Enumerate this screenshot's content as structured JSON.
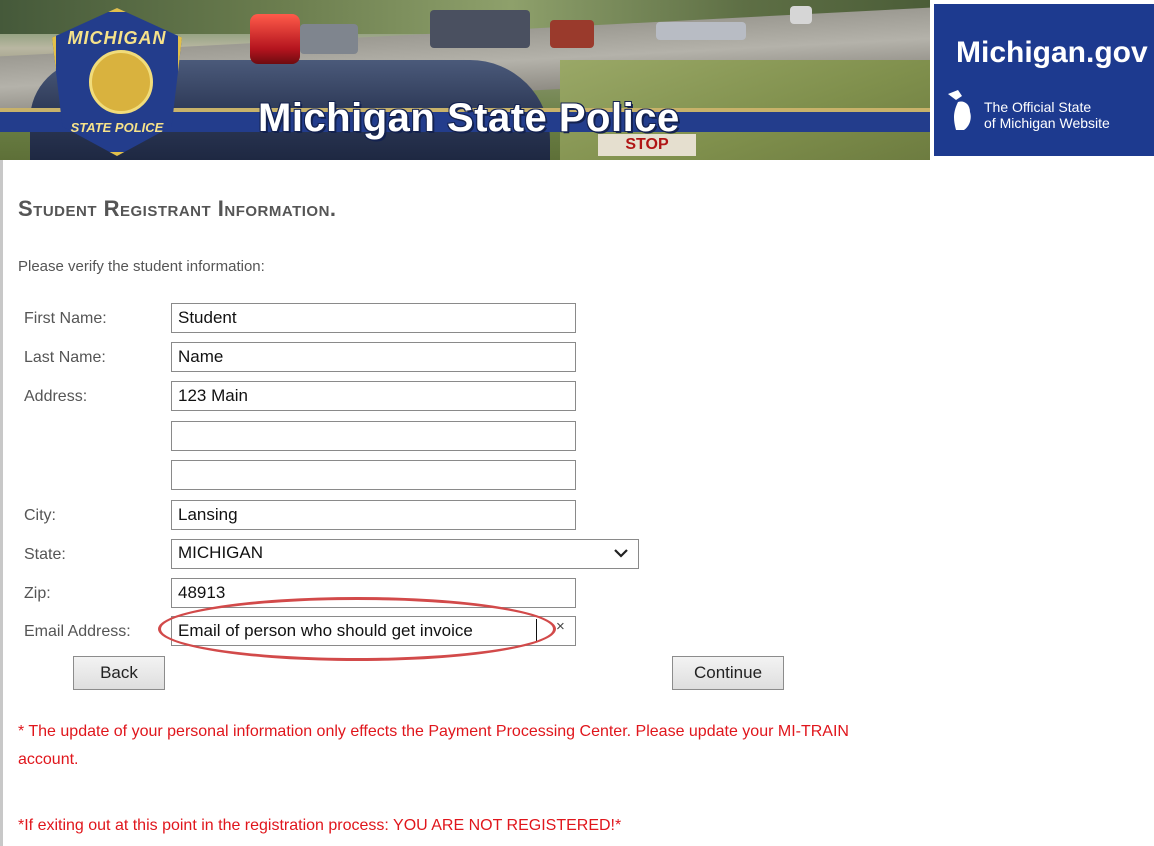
{
  "header": {
    "badge_top": "MICHIGAN",
    "badge_bottom": "STATE POLICE",
    "site_title": "Michigan State Police",
    "stop_sign": "STOP",
    "portal_title": "Michigan.gov",
    "portal_tagline_line1": "The Official State",
    "portal_tagline_line2": "of Michigan Website"
  },
  "form": {
    "heading": "Student Registrant Information.",
    "intro": "Please verify the student information:",
    "fields": {
      "first_name": {
        "label": "First Name:",
        "value": "Student"
      },
      "last_name": {
        "label": "Last Name:",
        "value": "Name"
      },
      "address": {
        "label": "Address:",
        "line1": "123 Main",
        "line2": "",
        "line3": ""
      },
      "city": {
        "label": "City:",
        "value": "Lansing"
      },
      "state": {
        "label": "State:",
        "value": "MICHIGAN"
      },
      "zip": {
        "label": "Zip:",
        "value": "48913"
      },
      "email": {
        "label": "Email Address:",
        "value": "Email of person who should get invoice",
        "clear_glyph": "×"
      }
    },
    "buttons": {
      "back": "Back",
      "continue": "Continue"
    }
  },
  "notes": {
    "update_line1": "* The update of your personal information only effects the Payment Processing Center. Please update your MI-TRAIN",
    "update_line2": "account.",
    "warning": "*If exiting out at this point in the registration process: YOU ARE NOT REGISTERED!*"
  },
  "colors": {
    "navy": "#233d8c",
    "gold": "#e2c04a",
    "note_red": "#e0161c",
    "highlight_red": "#d24a4a"
  },
  "icons": [
    "michigan-state-police-badge",
    "michigan-map-icon",
    "chevron-down-icon",
    "clear-icon"
  ]
}
